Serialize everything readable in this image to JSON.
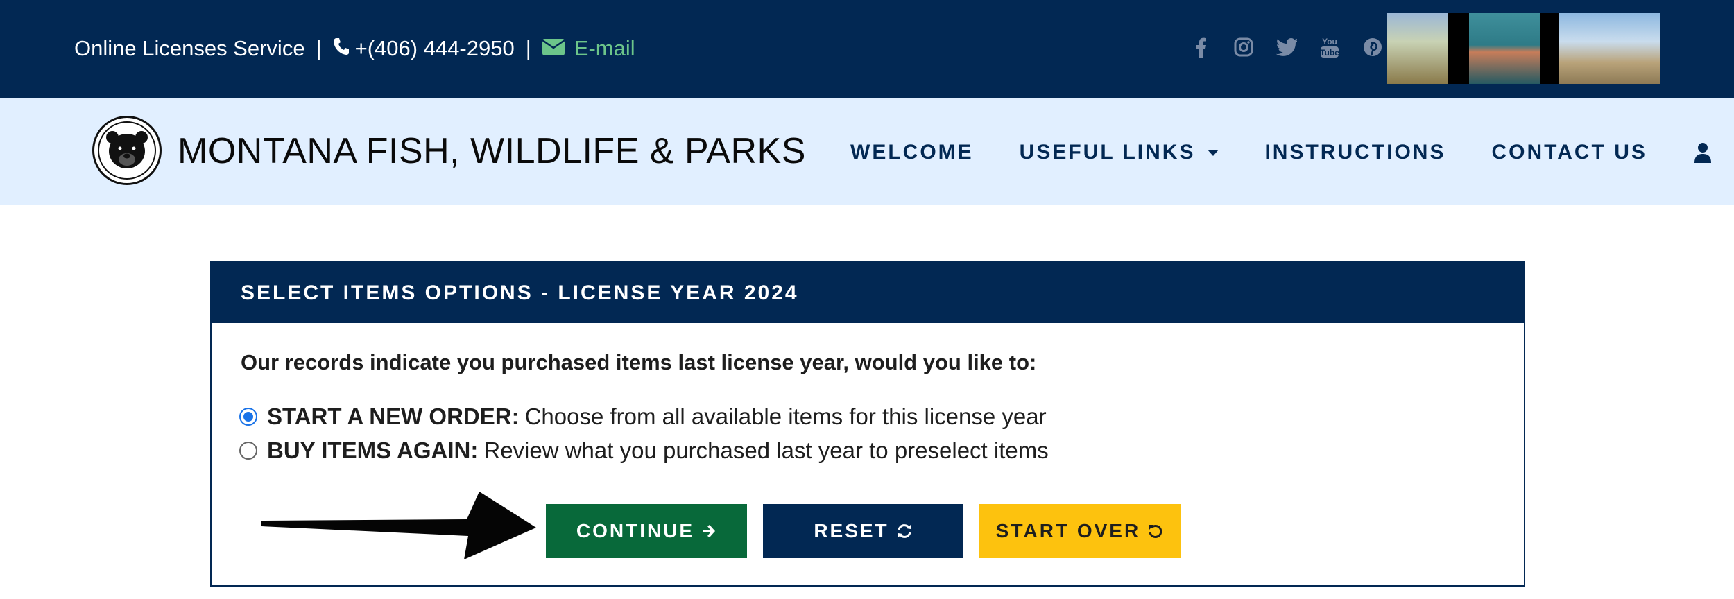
{
  "topbar": {
    "service_text": "Online Licenses Service",
    "separator": "|",
    "phone": "+(406) 444-2950",
    "email_label": "E-mail",
    "social_icons": [
      "facebook-icon",
      "instagram-icon",
      "twitter-icon",
      "youtube-icon",
      "pinterest-icon"
    ],
    "youtube_text": "You Tube"
  },
  "nav": {
    "logo_text": "MONTANA FISH, WILDLIFE & PARKS",
    "links": [
      "WELCOME",
      "USEFUL LINKS",
      "INSTRUCTIONS",
      "CONTACT US"
    ]
  },
  "panel": {
    "title": "SELECT ITEMS OPTIONS - LICENSE YEAR 2024",
    "question": "Our records indicate you purchased items last license year, would you like to:",
    "options": [
      {
        "bold": "START A NEW ORDER:",
        "text": "Choose from all available items for this license year",
        "checked": true
      },
      {
        "bold": "BUY ITEMS AGAIN:",
        "text": "Review what you purchased last year to preselect items",
        "checked": false
      }
    ],
    "buttons": {
      "continue": "CONTINUE",
      "reset": "RESET",
      "start_over": "START OVER"
    }
  },
  "colors": {
    "navy": "#022853",
    "nav_bg": "#e1efff",
    "green": "#08693a",
    "yellow": "#fdc20e",
    "email_green": "#6cc58a"
  }
}
